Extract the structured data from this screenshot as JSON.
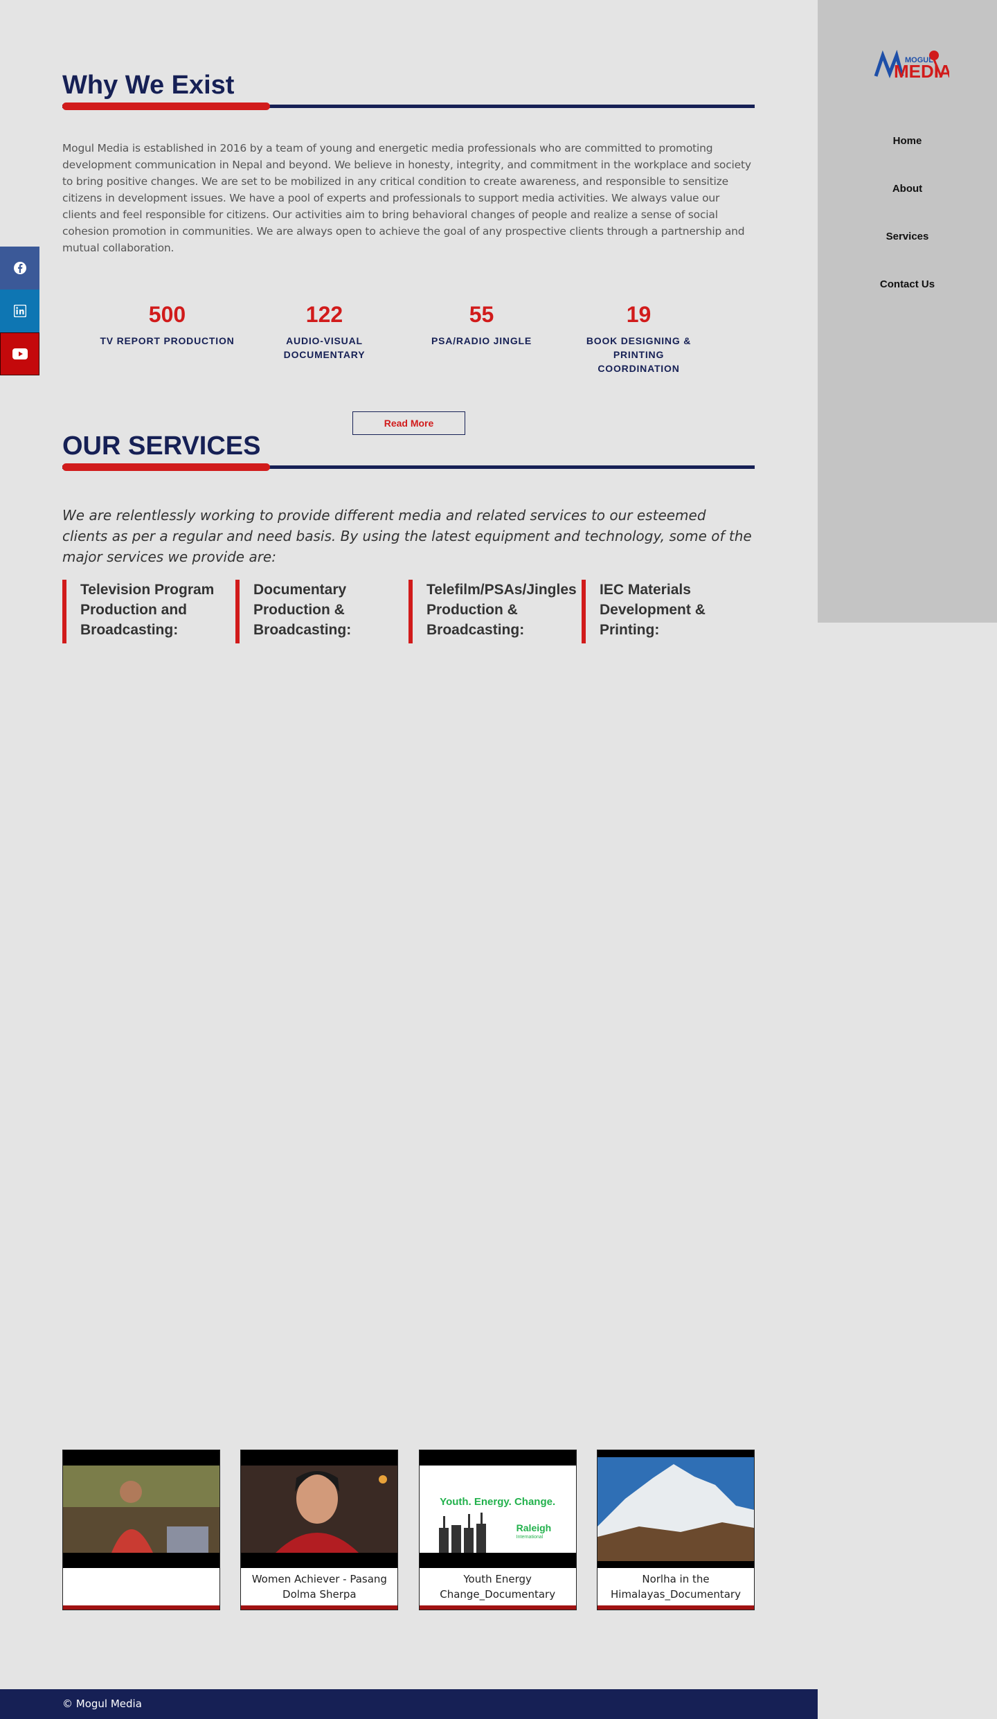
{
  "brand": {
    "logo_top": "MOGUL",
    "logo_main": "MEDIA",
    "logo_alt": "Mogul Media"
  },
  "nav": [
    {
      "label": "Home"
    },
    {
      "label": "About"
    },
    {
      "label": "Services"
    },
    {
      "label": "Contact Us"
    }
  ],
  "social": [
    {
      "icon": "facebook-icon",
      "color": "#3b5998"
    },
    {
      "icon": "linkedin-icon",
      "color": "#0e76b3"
    },
    {
      "icon": "youtube-icon",
      "color": "#c4090b"
    }
  ],
  "why": {
    "title": "Why We Exist",
    "text": "Mogul Media is established in 2016 by a team of young and energetic media professionals who are committed to promoting development communication in Nepal and beyond. We believe in honesty, integrity, and commitment in the workplace and society to bring positive changes. We are set to be mobilized in any critical condition to create awareness, and responsible to sensitize citizens in development issues. We have a pool of experts and professionals to support media activities. We always value our clients and feel responsible for citizens. Our activities aim to bring behavioral changes of people and realize a sense of social cohesion promotion in communities. We are always open to achieve the goal of any prospective clients through a partnership and mutual collaboration."
  },
  "stats": [
    {
      "number": "500",
      "label": "TV REPORT PRODUCTION"
    },
    {
      "number": "122",
      "label": "AUDIO-VISUAL DOCUMENTARY"
    },
    {
      "number": "55",
      "label": "PSA/RADIO JINGLE"
    },
    {
      "number": "19",
      "label": "BOOK DESIGNING & PRINTING COORDINATION"
    }
  ],
  "read_more": "Read More",
  "services": {
    "title": "OUR SERVICES",
    "lead": "We are relentlessly working to provide different media and related services to our esteemed clients as per a regular and need basis. By using the latest equipment and technology, some of the major services we provide are:",
    "items": [
      {
        "label": "Television Program Production and Broadcasting:"
      },
      {
        "label": "Documentary Production & Broadcasting:"
      },
      {
        "label": "Telefilm/PSAs/Jingles Production & Broadcasting:"
      },
      {
        "label": "IEC Materials Development & Printing:"
      }
    ]
  },
  "videos": [
    {
      "caption": ""
    },
    {
      "caption": "Women Achiever - Pasang Dolma Sherpa"
    },
    {
      "caption": "Youth Energy Change_Documentary",
      "thumb_title": "Youth. Energy. Change.",
      "thumb_brand": "Raleigh",
      "thumb_sub": "International"
    },
    {
      "caption": "Norlha in the Himalayas_Documentary"
    }
  ],
  "footer": {
    "text": "© Mogul Media"
  },
  "colors": {
    "navy": "#162055",
    "red": "#d11b1b",
    "sidebar": "#c4c4c4",
    "page": "#e4e4e4"
  }
}
